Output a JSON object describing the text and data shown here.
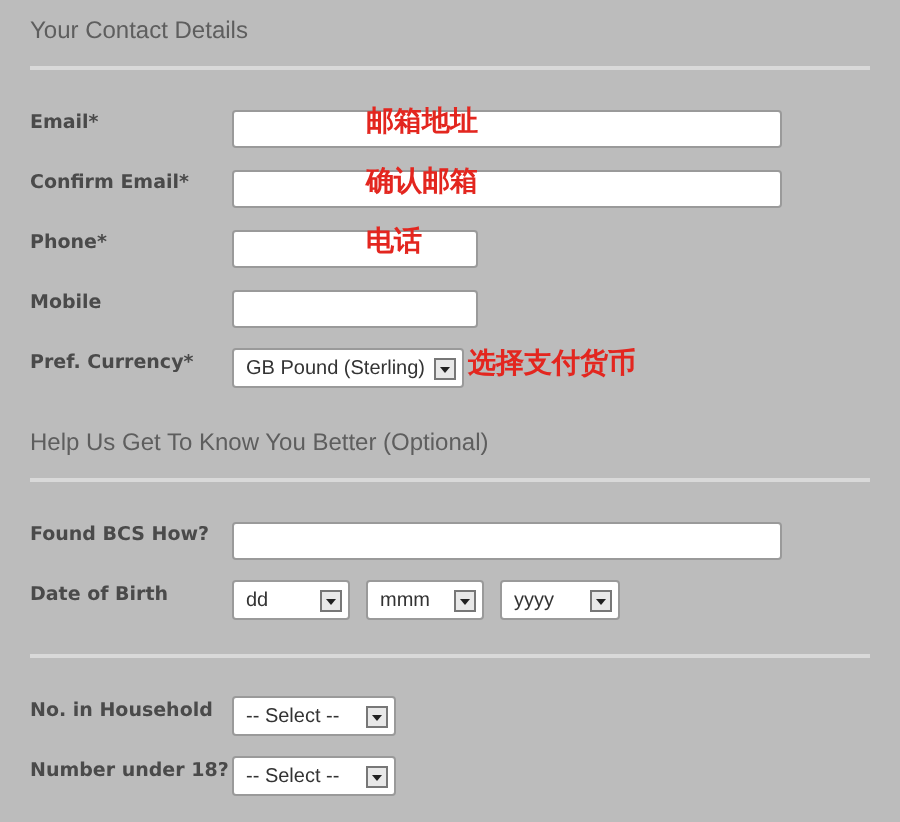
{
  "sections": [
    {
      "heading": "Your Contact Details",
      "fields": [
        {
          "label": "Email*",
          "kind": "long-text",
          "annotation": "邮箱地址"
        },
        {
          "label": "Confirm Email*",
          "kind": "long-text",
          "annotation": "确认邮箱"
        },
        {
          "label": "Phone*",
          "kind": "text",
          "annotation": "电话"
        },
        {
          "label": "Mobile",
          "kind": "text"
        },
        {
          "label": "Pref. Currency*",
          "kind": "select",
          "selects": [
            "GB Pound (Sterling)"
          ],
          "annotation": "选择支付货币"
        }
      ]
    },
    {
      "heading": "Help Us Get To Know You Better (Optional)",
      "fields": [
        {
          "label": "Found BCS How?",
          "kind": "long-text"
        },
        {
          "label": "Date of Birth",
          "kind": "select",
          "selects": [
            "dd",
            "mmm",
            "yyyy"
          ]
        }
      ]
    },
    {
      "fields": [
        {
          "label": "No. in Household",
          "kind": "select",
          "selects": [
            "-- Select --"
          ]
        },
        {
          "label": "Number under 18?",
          "kind": "select",
          "selects": [
            "-- Select --"
          ]
        }
      ]
    }
  ]
}
